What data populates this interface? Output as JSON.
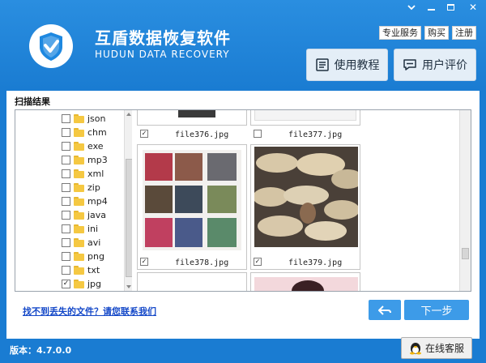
{
  "window": {
    "controls": {
      "down_icon": "chevron-down-icon",
      "minimize": "minimize-icon",
      "maximize": "maximize-icon",
      "close_label": "✕"
    }
  },
  "header": {
    "title_cn": "互盾数据恢复软件",
    "title_en": "HUDUN DATA RECOVERY",
    "links": [
      "专业服务",
      "购买",
      "注册"
    ],
    "buttons": {
      "tutorial": "使用教程",
      "reviews": "用户评价"
    }
  },
  "panel": {
    "title": "扫描结果",
    "tree_items": [
      {
        "label": "json",
        "checked": false
      },
      {
        "label": "chm",
        "checked": false
      },
      {
        "label": "exe",
        "checked": false
      },
      {
        "label": "mp3",
        "checked": false
      },
      {
        "label": "xml",
        "checked": false
      },
      {
        "label": "zip",
        "checked": false
      },
      {
        "label": "mp4",
        "checked": false
      },
      {
        "label": "java",
        "checked": false
      },
      {
        "label": "ini",
        "checked": false
      },
      {
        "label": "avi",
        "checked": false
      },
      {
        "label": "png",
        "checked": false
      },
      {
        "label": "txt",
        "checked": false
      },
      {
        "label": "jpg",
        "checked": true
      }
    ],
    "files": [
      {
        "name": "file376.jpg",
        "checked": true
      },
      {
        "name": "file377.jpg",
        "checked": false
      },
      {
        "name": "file378.jpg",
        "checked": true
      },
      {
        "name": "file379.jpg",
        "checked": true
      }
    ],
    "contact_link": "找不到丢失的文件？请您联系我们",
    "next_button": "下一步"
  },
  "footer": {
    "version": "版本：4.7.0.0",
    "support_button": "在线客服"
  },
  "colors": {
    "brand_blue": "#1a7cd2",
    "button_blue": "#3d9be8",
    "link_blue": "#1448c8"
  }
}
